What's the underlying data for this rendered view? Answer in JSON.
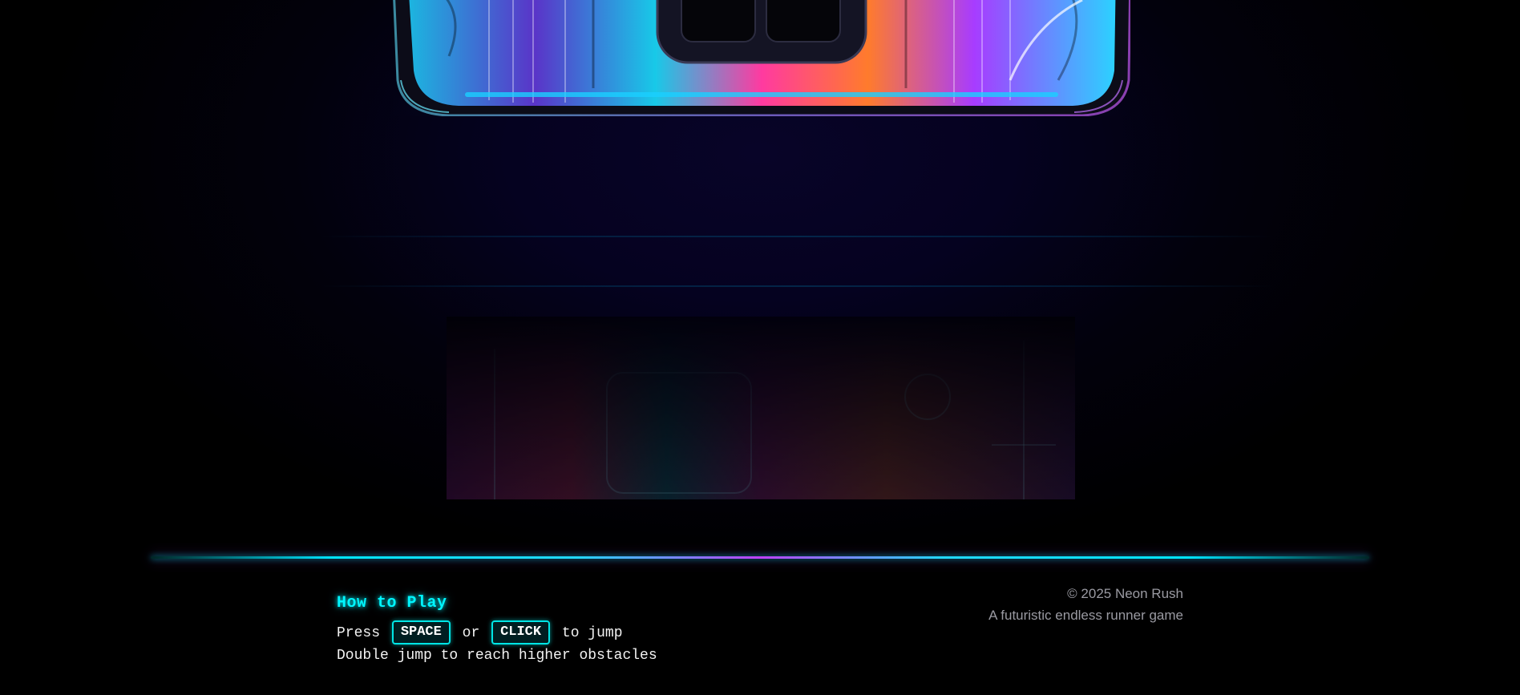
{
  "how_to_play": {
    "title": "How to Play",
    "line1_prefix": "Press",
    "key_space": "SPACE",
    "line1_or": "or",
    "key_click": "CLICK",
    "line1_suffix": "to jump",
    "line2": "Double jump to reach higher obstacles"
  },
  "footer": {
    "copyright": "© 2025 Neon Rush",
    "tagline": "A futuristic endless runner game"
  },
  "colors": {
    "neon_cyan": "#00f6ff",
    "neon_magenta": "#c040ff",
    "background": "#000000"
  },
  "icons": {
    "console_art": "neon-game-console-art"
  }
}
